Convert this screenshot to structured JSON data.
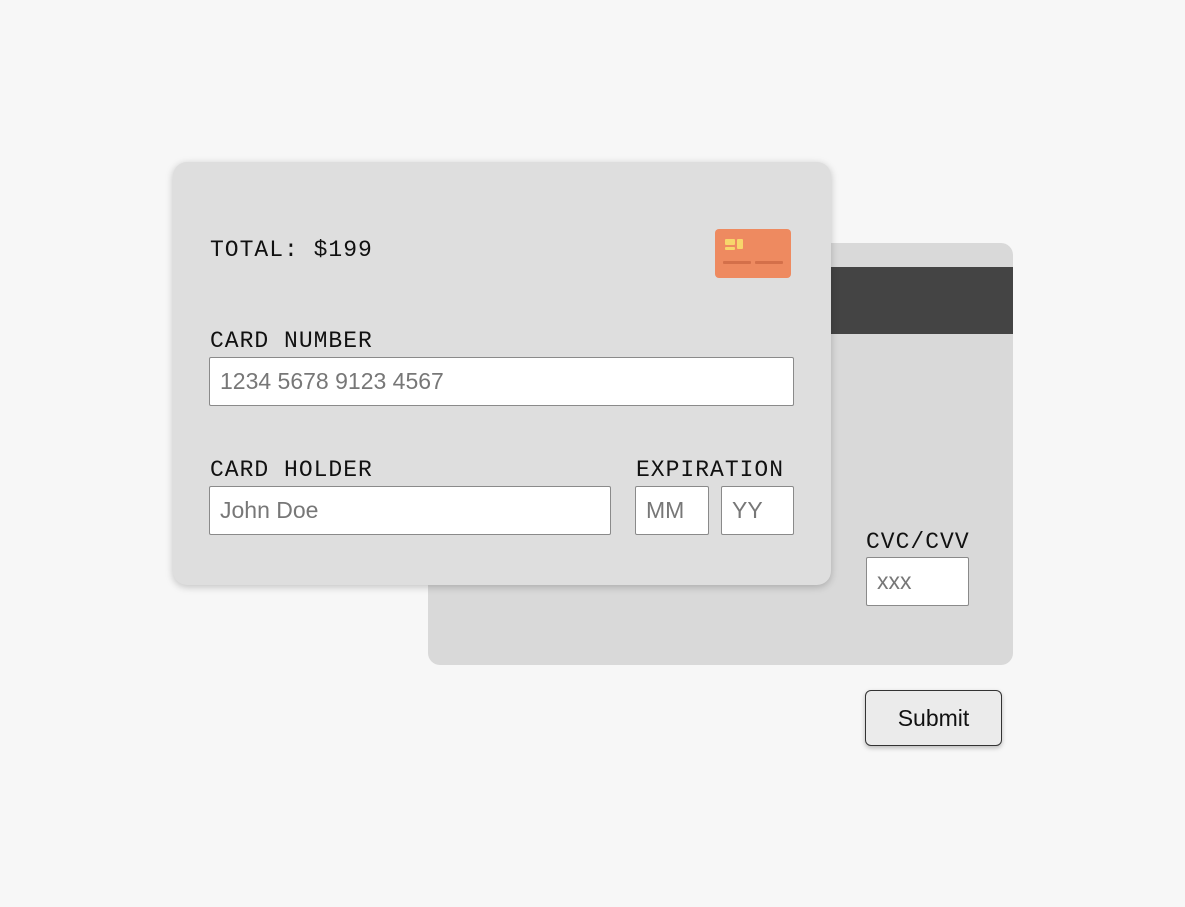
{
  "front_card": {
    "total_label": "TOTAL: $199",
    "card_number": {
      "label": "CARD NUMBER",
      "placeholder": "1234 5678 9123 4567",
      "value": ""
    },
    "card_holder": {
      "label": "CARD HOLDER",
      "placeholder": "John Doe",
      "value": ""
    },
    "expiration": {
      "label": "EXPIRATION",
      "month_placeholder": "MM",
      "year_placeholder": "YY"
    },
    "card_icon": "credit-card-icon"
  },
  "back_card": {
    "cvc": {
      "label": "CVC/CVV",
      "placeholder": "xxx",
      "value": ""
    }
  },
  "submit_label": "Submit",
  "colors": {
    "page_background": "#f7f7f7",
    "card_front": "#dedede",
    "card_back": "#d9d9d9",
    "magstripe": "#444444",
    "card_icon": "#ee8a60",
    "card_icon_chip": "#f7d66b"
  }
}
